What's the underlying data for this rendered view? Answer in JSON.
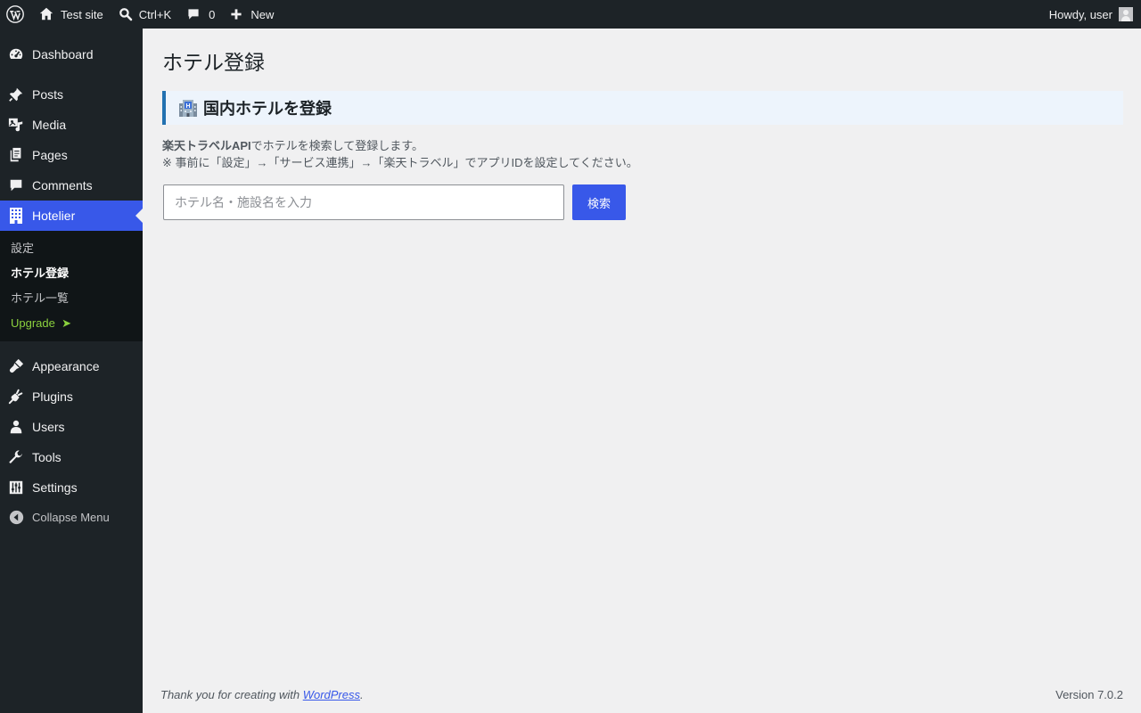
{
  "admin_bar": {
    "site_name": "Test site",
    "search_shortcut": "Ctrl+K",
    "comments_count": "0",
    "new_label": "New",
    "greeting": "Howdy, user"
  },
  "sidebar": {
    "items": [
      {
        "label": "Dashboard",
        "icon": "dashboard-icon"
      },
      {
        "label": "Posts",
        "icon": "pin-icon"
      },
      {
        "label": "Media",
        "icon": "media-icon"
      },
      {
        "label": "Pages",
        "icon": "pages-icon"
      },
      {
        "label": "Comments",
        "icon": "comment-icon"
      },
      {
        "label": "Hotelier",
        "icon": "building-icon"
      },
      {
        "label": "Appearance",
        "icon": "brush-icon"
      },
      {
        "label": "Plugins",
        "icon": "plug-icon"
      },
      {
        "label": "Users",
        "icon": "user-icon"
      },
      {
        "label": "Tools",
        "icon": "wrench-icon"
      },
      {
        "label": "Settings",
        "icon": "sliders-icon"
      }
    ],
    "submenu": [
      "設定",
      "ホテル登録",
      "ホテル一覧"
    ],
    "upgrade_label": "Upgrade",
    "upgrade_arrow": "➤",
    "collapse_label": "Collapse Menu"
  },
  "main": {
    "page_title": "ホテル登録",
    "section_title": "国内ホテルを登録",
    "desc_bold": "楽天トラベルAPI",
    "desc_line1_rest": "でホテルを検索して登録します。",
    "desc_line2": "※ 事前に「設定」→「サービス連携」→「楽天トラベル」でアプリIDを設定してください。",
    "search": {
      "placeholder": "ホテル名・施設名を入力",
      "value": "",
      "button_label": "検索"
    }
  },
  "footer": {
    "thanks_prefix": "Thank you for creating with ",
    "wordpress_link": "WordPress",
    "thanks_suffix": ".",
    "version": "Version 7.0.2"
  },
  "colors": {
    "accent": "#3858e9",
    "admin_bar": "#1d2327",
    "submenu_bg": "#101517",
    "upgrade": "#8bd13e",
    "section_border": "#2271b1"
  }
}
